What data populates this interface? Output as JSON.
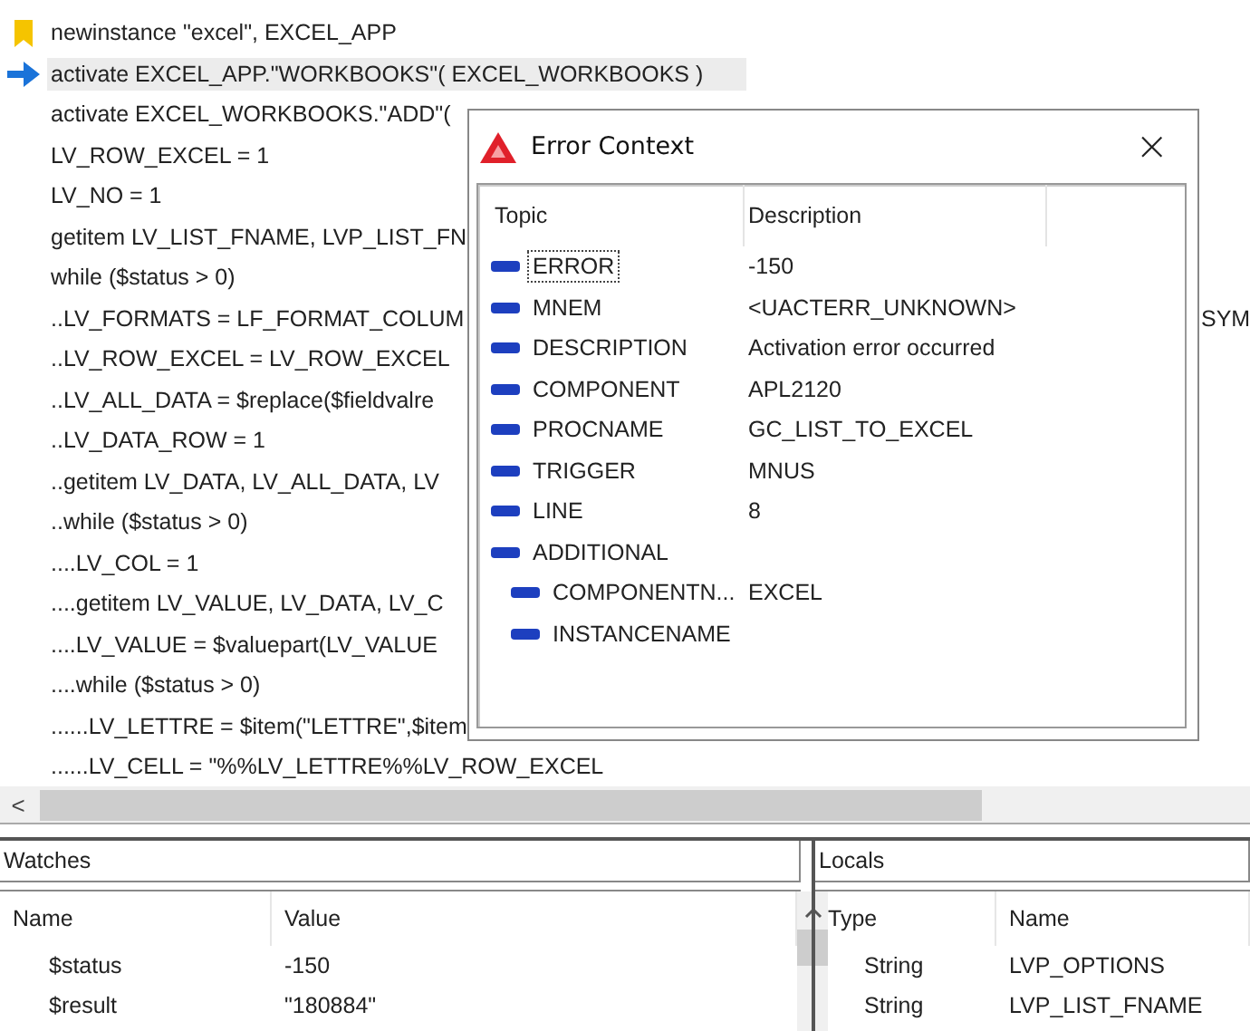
{
  "code_lines": [
    {
      "text": "newinstance \"excel\", EXCEL_APP",
      "bookmarked": true,
      "current": false
    },
    {
      "text": "activate EXCEL_APP.\"WORKBOOKS\"( EXCEL_WORKBOOKS )",
      "bookmarked": false,
      "current": true
    },
    {
      "text": "activate EXCEL_WORKBOOKS.\"ADD\"(",
      "bookmarked": false,
      "current": false
    },
    {
      "text": "LV_ROW_EXCEL = 1",
      "bookmarked": false,
      "current": false
    },
    {
      "text": "LV_NO = 1",
      "bookmarked": false,
      "current": false
    },
    {
      "text": "getitem LV_LIST_FNAME, LVP_LIST_FN",
      "bookmarked": false,
      "current": false
    },
    {
      "text": "while ($status > 0)",
      "bookmarked": false,
      "current": false
    },
    {
      "text": "..LV_FORMATS = LF_FORMAT_COLUM",
      "tail": "SYM",
      "bookmarked": false,
      "current": false
    },
    {
      "text": "..LV_ROW_EXCEL = LV_ROW_EXCEL",
      "bookmarked": false,
      "current": false
    },
    {
      "text": "..LV_ALL_DATA = $replace($fieldvalre",
      "bookmarked": false,
      "current": false
    },
    {
      "text": "..LV_DATA_ROW = 1",
      "bookmarked": false,
      "current": false
    },
    {
      "text": "..getitem LV_DATA, LV_ALL_DATA, LV",
      "bookmarked": false,
      "current": false
    },
    {
      "text": "..while ($status > 0)",
      "bookmarked": false,
      "current": false
    },
    {
      "text": "....LV_COL = 1",
      "bookmarked": false,
      "current": false
    },
    {
      "text": "....getitem LV_VALUE, LV_DATA, LV_C",
      "bookmarked": false,
      "current": false
    },
    {
      "text": "....LV_VALUE = $valuepart(LV_VALUE",
      "bookmarked": false,
      "current": false
    },
    {
      "text": "....while ($status > 0)",
      "bookmarked": false,
      "current": false
    },
    {
      "text": "......LV_LETTRE = $item(\"LETTRE\",$item",
      "bookmarked": false,
      "current": false
    },
    {
      "text": "......LV_CELL = \"%%LV_LETTRE%%LV_ROW_EXCEL",
      "bookmarked": false,
      "current": false
    }
  ],
  "dialog": {
    "title": "Error Context",
    "close": "×",
    "columns": [
      "Topic",
      "Description"
    ],
    "items": [
      {
        "topic": "ERROR",
        "description": "-150",
        "selected": true
      },
      {
        "topic": "MNEM",
        "description": "<UACTERR_UNKNOWN>",
        "selected": false
      },
      {
        "topic": "DESCRIPTION",
        "description": "Activation error occurred",
        "selected": false
      },
      {
        "topic": "COMPONENT",
        "description": "APL2120",
        "selected": false
      },
      {
        "topic": "PROCNAME",
        "description": "GC_LIST_TO_EXCEL",
        "selected": false
      },
      {
        "topic": "TRIGGER",
        "description": "MNUS",
        "selected": false
      },
      {
        "topic": "LINE",
        "description": "8",
        "selected": false
      },
      {
        "topic": "ADDITIONAL",
        "selected": false,
        "children": [
          {
            "topic": "COMPONENTN...",
            "description": "EXCEL",
            "selected": false
          },
          {
            "topic": "INSTANCENAME",
            "selected": false
          }
        ]
      }
    ]
  },
  "scroll_left": "<",
  "watches": {
    "title": "Watches",
    "columns": [
      "Name",
      "Value"
    ],
    "rows": [
      [
        "$status",
        "-150"
      ],
      [
        "$result",
        "\"180884\""
      ]
    ]
  },
  "locals": {
    "title": "Locals",
    "columns": [
      "Type",
      "Name"
    ],
    "rows": [
      [
        "String",
        "LVP_OPTIONS"
      ],
      [
        "String",
        "LVP_LIST_FNAME"
      ]
    ]
  }
}
